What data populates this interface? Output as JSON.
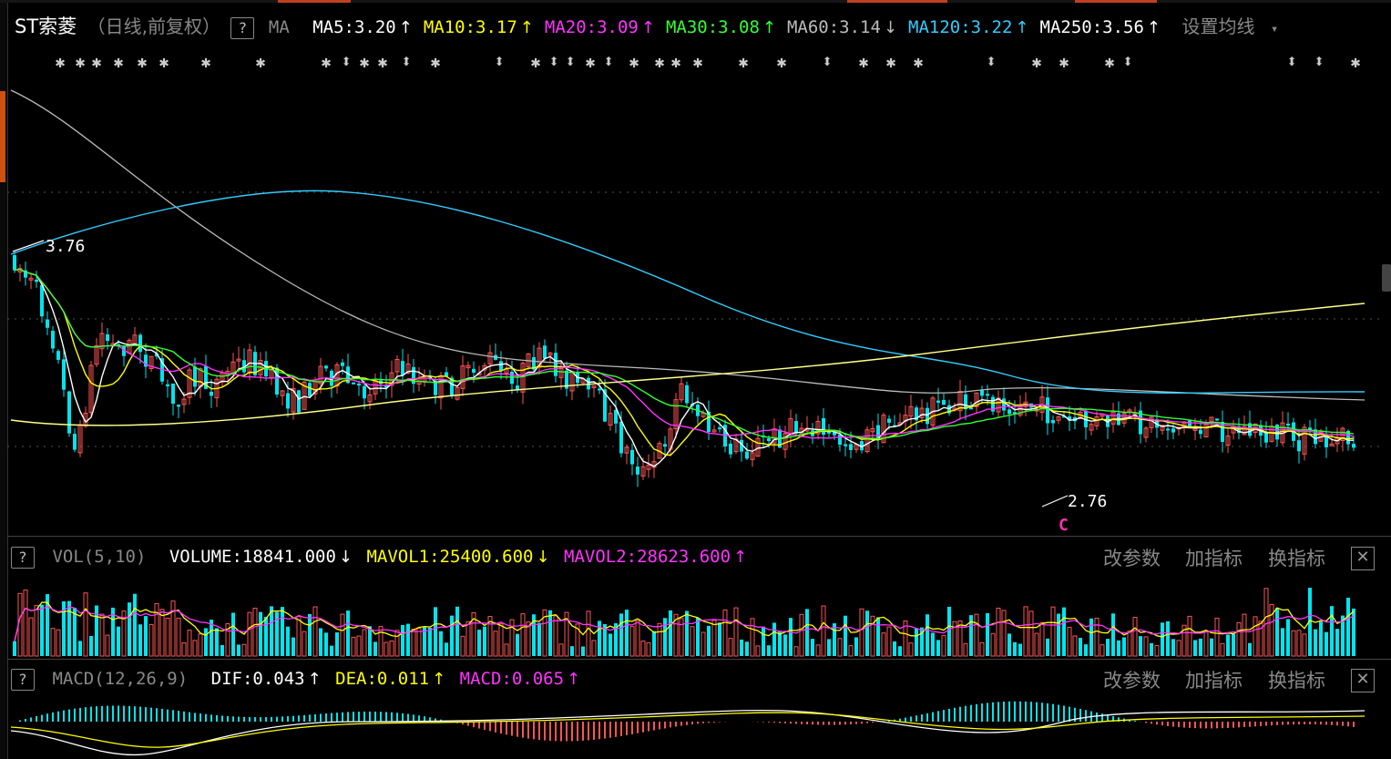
{
  "main": {
    "stock_name": "ST索菱",
    "period_label": "（日线,前复权）",
    "help_glyph": "?",
    "ma_label": "MA",
    "ma_values": [
      {
        "name": "MA5",
        "value": "3.20",
        "dir": "↑",
        "color": "#ffffff"
      },
      {
        "name": "MA10",
        "value": "3.17",
        "dir": "↑",
        "color": "#ffff00"
      },
      {
        "name": "MA20",
        "value": "3.09",
        "dir": "↑",
        "color": "#ff33ff"
      },
      {
        "name": "MA30",
        "value": "3.08",
        "dir": "↑",
        "color": "#33ff33"
      },
      {
        "name": "MA60",
        "value": "3.14",
        "dir": "↓",
        "color": "#bbbbbb"
      },
      {
        "name": "MA120",
        "value": "3.22",
        "dir": "↑",
        "color": "#33ccff"
      },
      {
        "name": "MA250",
        "value": "3.56",
        "dir": "↑",
        "color": "#ffffff"
      }
    ],
    "settings_label": "设置均线",
    "dropdown_glyph": "▾",
    "high_label": "3.76",
    "low_label": "2.76",
    "c_marker": "C"
  },
  "volume": {
    "help_glyph": "?",
    "indicator_name": "VOL(5,10)",
    "volume_label": "VOLUME:18841.000",
    "volume_dir": "↓",
    "mavol1_label": "MAVOL1:25400.600",
    "mavol1_dir": "↓",
    "mavol2_label": "MAVOL2:28623.600",
    "mavol2_dir": "↑",
    "change_params": "改参数",
    "add_indicator": "加指标",
    "switch_indicator": "换指标",
    "close_glyph": "✕"
  },
  "macd": {
    "help_glyph": "?",
    "indicator_name": "MACD(12,26,9)",
    "dif_label": "DIF:0.043",
    "dif_dir": "↑",
    "dea_label": "DEA:0.011",
    "dea_dir": "↑",
    "macd_label": "MACD:0.065",
    "macd_dir": "↑",
    "change_params": "改参数",
    "add_indicator": "加指标",
    "switch_indicator": "换指标",
    "close_glyph": "✕"
  },
  "colors": {
    "up": "#ff5555",
    "down": "#00e5ee",
    "ma5": "#ffffff",
    "ma10": "#ffff00",
    "ma20": "#ff33ff",
    "ma30": "#33ff33",
    "ma60": "#bbbbbb",
    "ma120": "#33ccff",
    "ma250": "#ffff88"
  }
}
